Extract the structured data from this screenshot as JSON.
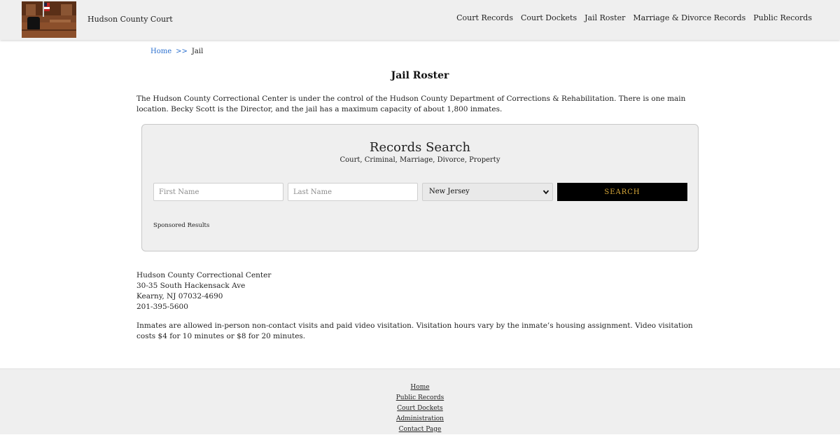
{
  "header": {
    "site_name": "Hudson County Court",
    "nav": [
      "Court Records",
      "Court Dockets",
      "Jail Roster",
      "Marriage & Divorce Records",
      "Public Records"
    ]
  },
  "breadcrumb": {
    "home": "Home",
    "separator": ">>",
    "current": "Jail"
  },
  "page_title": "Jail Roster",
  "intro": "The Hudson County Correctional Center is under the control of the Hudson County Department of Corrections & Rehabilitation. There is one main location. Becky Scott is the Director, and the jail has a maximum capacity of about 1,800 inmates.",
  "search": {
    "title": "Records Search",
    "subtitle": "Court, Criminal, Marriage, Divorce, Property",
    "first_name_placeholder": "First Name",
    "last_name_placeholder": "Last Name",
    "state_selected": "New Jersey",
    "button_label": "SEARCH",
    "sponsored": "Sponsored Results"
  },
  "address": {
    "name": "Hudson County Correctional Center",
    "street": "30-35 South Hackensack Ave",
    "city": "Kearny, NJ 07032-4690",
    "phone": "201-395-5600"
  },
  "visitation": "Inmates are allowed in-person non-contact visits and paid video visitation. Visitation hours vary by the inmate’s housing assignment. Video visitation costs $4 for 10 minutes or $8 for 20 minutes.",
  "footer": {
    "links": [
      "Home",
      "Public Records",
      "Court Dockets",
      "Administration",
      "Contact Page"
    ]
  },
  "colors": {
    "link": "#2a6fcf",
    "button_bg": "#000000",
    "button_text": "#d9a93a",
    "panel_bg": "#efefef"
  }
}
